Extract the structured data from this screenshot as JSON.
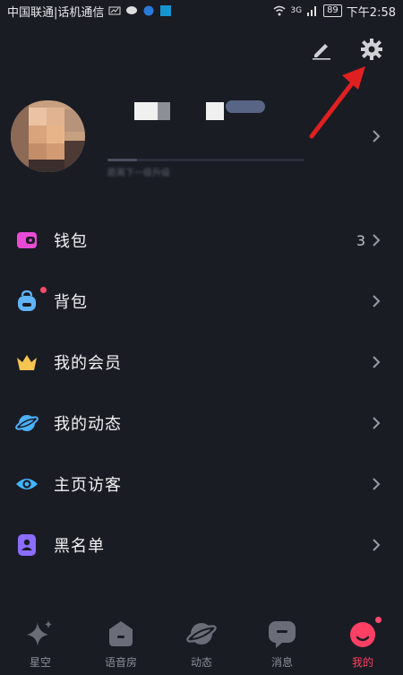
{
  "status_bar": {
    "carrier": "中国联通|话机通信",
    "battery": "89",
    "network": "3G",
    "time": "下午2:58"
  },
  "profile": {
    "level_progress": 0.15,
    "level_caption": "距离下一级升级"
  },
  "menu": [
    {
      "label": "钱包",
      "value": "3",
      "icon": "wallet-icon",
      "badge": false
    },
    {
      "label": "背包",
      "value": "",
      "icon": "backpack-icon",
      "badge": true
    },
    {
      "label": "我的会员",
      "value": "",
      "icon": "crown-icon",
      "badge": false
    },
    {
      "label": "我的动态",
      "value": "",
      "icon": "planet-icon",
      "badge": false
    },
    {
      "label": "主页访客",
      "value": "",
      "icon": "eye-icon",
      "badge": false
    },
    {
      "label": "黑名单",
      "value": "",
      "icon": "blocklist-icon",
      "badge": false
    }
  ],
  "tabs": [
    {
      "label": "星空",
      "icon": "sparkle-icon",
      "active": false
    },
    {
      "label": "语音房",
      "icon": "voice-room-icon",
      "active": false
    },
    {
      "label": "动态",
      "icon": "planet-icon",
      "active": false
    },
    {
      "label": "消息",
      "icon": "message-icon",
      "active": false
    },
    {
      "label": "我的",
      "icon": "me-icon",
      "active": true
    }
  ],
  "colors": {
    "background": "#1a1c24",
    "accent": "#ff3f64",
    "wallet": "#e94bd6",
    "backpack": "#5fb3ff",
    "crown": "#f5c451",
    "planet": "#4ab0ff",
    "eye": "#41b6ff",
    "blocklist": "#8c6dff",
    "annotation_arrow": "#e02020"
  }
}
